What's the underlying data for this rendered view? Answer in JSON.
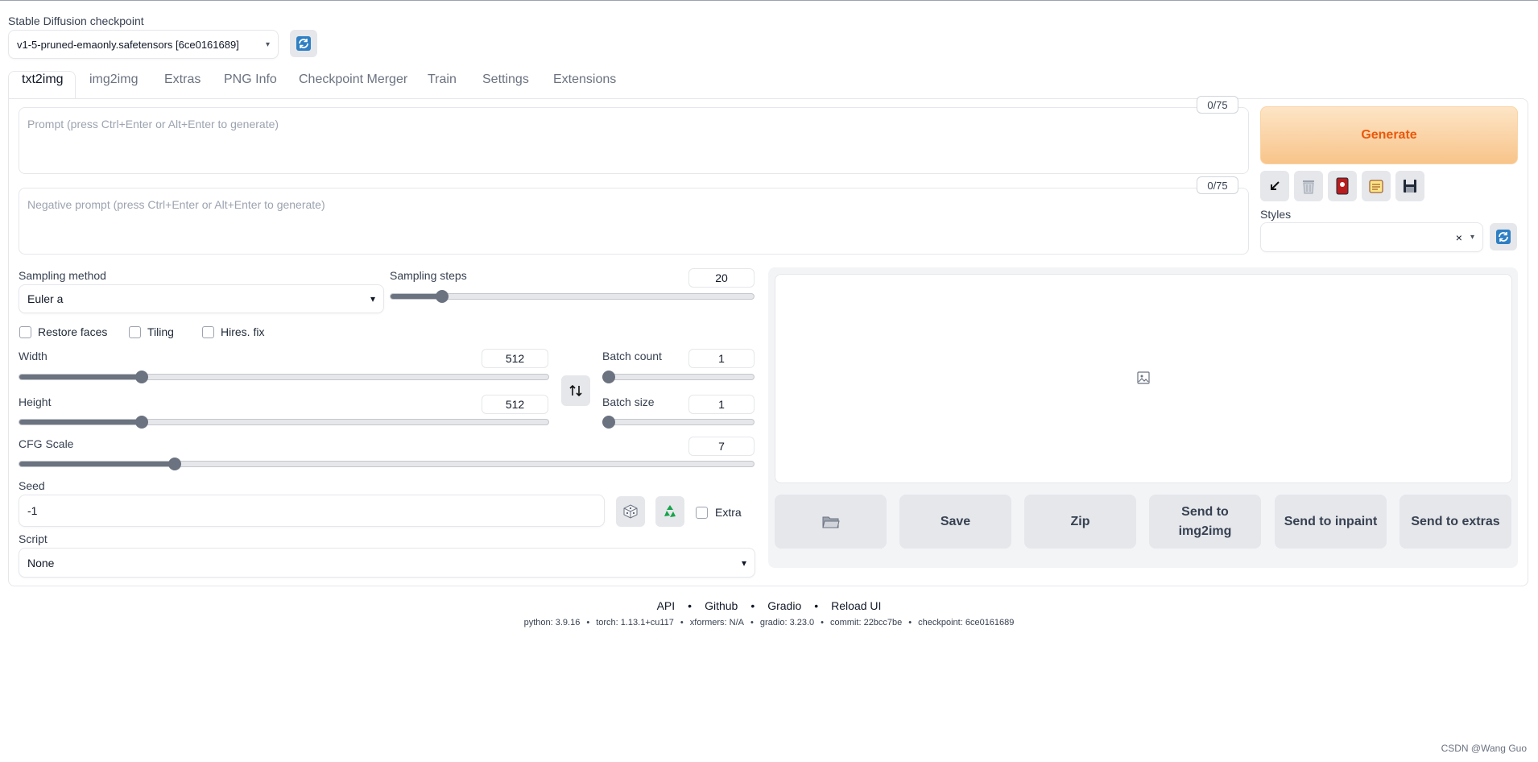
{
  "checkpoint": {
    "label": "Stable Diffusion checkpoint",
    "value": "v1-5-pruned-emaonly.safetensors [6ce0161689]"
  },
  "tabs": [
    "txt2img",
    "img2img",
    "Extras",
    "PNG Info",
    "Checkpoint Merger",
    "Train",
    "Settings",
    "Extensions"
  ],
  "prompt": {
    "placeholder": "Prompt (press Ctrl+Enter or Alt+Enter to generate)",
    "counter": "0/75"
  },
  "negative_prompt": {
    "placeholder": "Negative prompt (press Ctrl+Enter or Alt+Enter to generate)",
    "counter": "0/75"
  },
  "generate_label": "Generate",
  "styles": {
    "label": "Styles",
    "clear": "×"
  },
  "sampling": {
    "method_label": "Sampling method",
    "method_value": "Euler a",
    "steps_label": "Sampling steps",
    "steps_value": "20"
  },
  "checkboxes": {
    "restore_faces": "Restore faces",
    "tiling": "Tiling",
    "hires_fix": "Hires. fix",
    "extra": "Extra"
  },
  "width": {
    "label": "Width",
    "value": "512"
  },
  "height": {
    "label": "Height",
    "value": "512"
  },
  "batch_count": {
    "label": "Batch count",
    "value": "1"
  },
  "batch_size": {
    "label": "Batch size",
    "value": "1"
  },
  "cfg_scale": {
    "label": "CFG Scale",
    "value": "7"
  },
  "seed": {
    "label": "Seed",
    "value": "-1"
  },
  "script": {
    "label": "Script",
    "value": "None"
  },
  "output_buttons": {
    "save": "Save",
    "zip": "Zip",
    "send_img2img_line1": "Send to",
    "send_img2img_line2": "img2img",
    "send_inpaint": "Send to inpaint",
    "send_extras": "Send to extras"
  },
  "footer": {
    "links": [
      "API",
      "Github",
      "Gradio",
      "Reload UI"
    ],
    "separator": "•",
    "info": [
      "python: 3.9.16",
      "torch: 1.13.1+cu117",
      "xformers: N/A",
      "gradio: 3.23.0",
      "commit: 22bcc7be",
      "checkpoint: 6ce0161689"
    ]
  },
  "watermark": "CSDN @Wang Guo",
  "colors": {
    "generate_bg_start": "#fde5c6",
    "generate_bg_end": "#f8c48a",
    "generate_text": "#ea580c",
    "slider_fill": "#6b7280",
    "refresh_icon": "#2e7fc4"
  }
}
